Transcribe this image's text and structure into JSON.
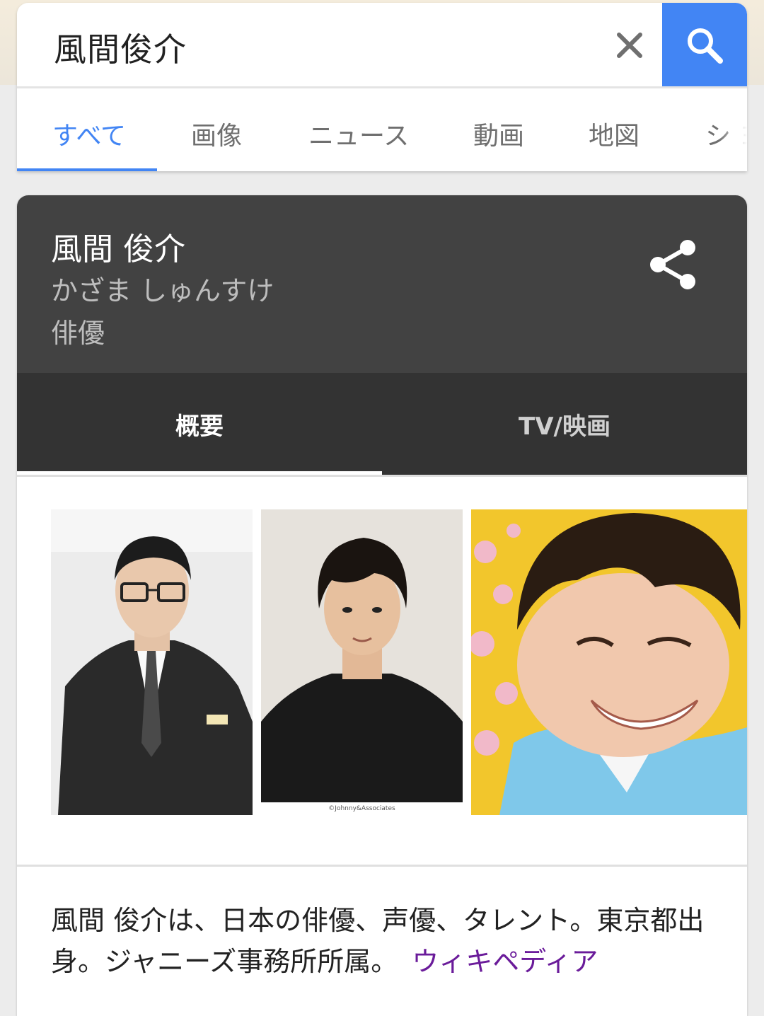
{
  "search": {
    "query": "風間俊介",
    "clear_icon": "close-icon",
    "search_icon": "search-icon",
    "accent": "#4285f4"
  },
  "tabs": [
    {
      "label": "すべて",
      "active": true
    },
    {
      "label": "画像"
    },
    {
      "label": "ニュース"
    },
    {
      "label": "動画"
    },
    {
      "label": "地図"
    },
    {
      "label": "シ ヨ"
    }
  ],
  "knowledge_panel": {
    "name": "風間 俊介",
    "reading": "かざま しゅんすけ",
    "type": "俳優",
    "share_icon": "share-icon",
    "tabs": [
      {
        "label": "概要",
        "active": true
      },
      {
        "label": "TV/映画"
      }
    ],
    "photos": [
      {
        "credit": ""
      },
      {
        "credit": "©Johnny&Associates"
      },
      {
        "credit": ""
      }
    ],
    "description": "風間 俊介は、日本の俳優、声優、タレント。東京都出身。ジャニーズ事務所所属。",
    "source_link": "ウィキペディア",
    "link_color": "#6a1b9a"
  }
}
